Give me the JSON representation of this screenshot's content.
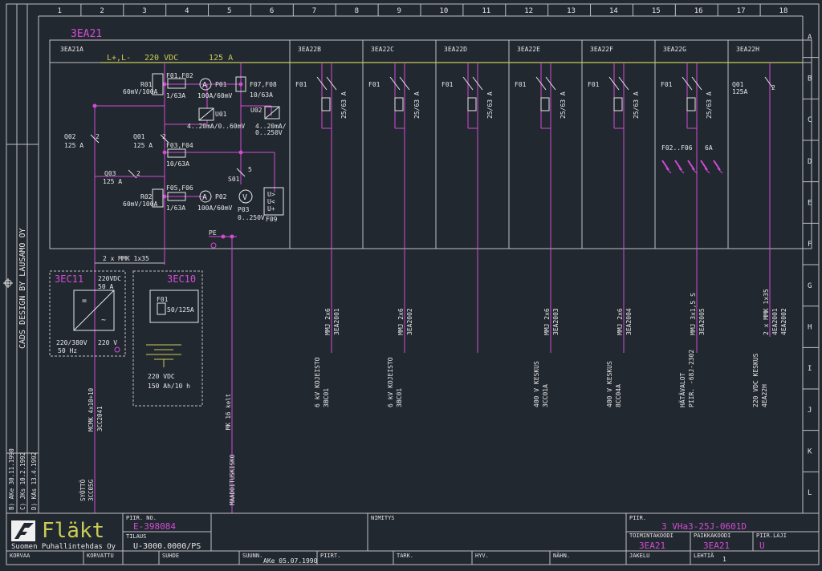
{
  "colors": {
    "background": "#222830",
    "frame": "#c0c0c0",
    "accent": "#d24bd6",
    "bus": "#c9cc55",
    "text": "#e6e6e6"
  },
  "grid": {
    "columns": [
      "1",
      "2",
      "3",
      "4",
      "5",
      "6",
      "7",
      "8",
      "9",
      "10",
      "11",
      "12",
      "13",
      "14",
      "15",
      "16",
      "17",
      "18"
    ],
    "rows": [
      "A",
      "B",
      "C",
      "D",
      "E",
      "F",
      "G",
      "H",
      "I",
      "J",
      "K",
      "L"
    ]
  },
  "main": {
    "title": "3EA21",
    "busbar": "L+,L-",
    "busbar_voltage": "220 VDC",
    "busbar_current": "125 A",
    "pe": "PE",
    "cable_top": "2 x MMK 1x35",
    "incoming": {
      "id": "3EA21A",
      "r01": "R01",
      "r01v": "60mV/100A",
      "f01": "F01,F02",
      "f01v": "1/63A",
      "p01": "P01",
      "p01v": "100A/60mV",
      "u01": "U01",
      "u01v": "4..20mA/0..60mV",
      "f07": "F07,F08",
      "f07v": "10/63A",
      "u02": "U02",
      "u02v": "4..20mA/",
      "u02v2": "0..250V",
      "q02": "Q02",
      "q02v": "125 A",
      "q02n": "2",
      "q01": "Q01",
      "q01v": "125 A",
      "q01n": "2",
      "f03": "F03,F04",
      "f03v": "10/63A",
      "q03": "Q03",
      "q03v": "125 A",
      "q03n": "2",
      "r02": "R02",
      "r02v": "60mV/100A",
      "f05": "F05,F06",
      "f05v": "1/63A",
      "p02": "P02",
      "p02v": "100A/60mV",
      "s01": "S01",
      "s01n": "5",
      "p03": "P03",
      "p03v": "0..250V",
      "f09": "F09",
      "f09l1": "U>",
      "f09l2": "U<",
      "f09l3": "U+",
      "sym_a": "A",
      "sym_v": "V"
    },
    "feeders": [
      {
        "id": "3EA22B",
        "dev": "F01",
        "rating": "25/63 A",
        "cable": "MMJ 2x6",
        "cable_id": "3EA2001",
        "dest": "6 kV KOJEISTO",
        "dest_id": "3BC01"
      },
      {
        "id": "3EA22C",
        "dev": "F01",
        "rating": "25/63 A",
        "cable": "MMJ 2x6",
        "cable_id": "3EA2002",
        "dest": "6 kV KOJEISTO",
        "dest_id": "3BC01"
      },
      {
        "id": "3EA22D",
        "dev": "F01",
        "rating": "25/63 A",
        "cable": "",
        "cable_id": "",
        "dest": "",
        "dest_id": ""
      },
      {
        "id": "3EA22E",
        "dev": "F01",
        "rating": "25/63 A",
        "cable": "MMJ 2x6",
        "cable_id": "3EA2003",
        "dest": "400 V KESKUS",
        "dest_id": "3CC01A"
      },
      {
        "id": "3EA22F",
        "dev": "F01",
        "rating": "25/63 A",
        "cable": "MMJ 2x6",
        "cable_id": "3EA2004",
        "dest": "400 V KESKUS",
        "dest_id": "8CC04A"
      },
      {
        "id": "3EA22G",
        "dev": "F01",
        "rating": "25/63 A",
        "cable": "MMJ 3x1,5 S",
        "cable_id": "3EA2005",
        "dest": "HÄTÄVALOT",
        "dest_id": "PIIR. -68J-2302"
      },
      {
        "id": "3EA22H",
        "dev": "Q01",
        "rating": "125A",
        "cable": "2 x MMK 1x35",
        "cable_id": "4EA2001",
        "cable_id2": "4EA2002",
        "dest": "220 VDC KESKUS",
        "dest_id": "4EA22H"
      }
    ],
    "g_fuses": {
      "label": "F02..F06",
      "rating": "6A"
    },
    "q01h_n": "2"
  },
  "charger": {
    "id": "3EC11",
    "dc": "220VDC",
    "dc_a": "50 A",
    "ac": "220/380V",
    "ac2": "50 Hz",
    "out": "220 V",
    "sym1": "=",
    "sym2": "~",
    "cable": "MCMK 4x10+10",
    "cable_id": "3CC2041",
    "src": "SYÖTTÖ",
    "src_id": "3CC05G"
  },
  "battery": {
    "id": "3EC10",
    "fuse": "F01",
    "fuse_v": "50/125A",
    "voltage": "220 VDC",
    "capacity": "150 Ah/10 h"
  },
  "earth": {
    "cable": "MK 16 kelt",
    "dest": "MAADOITUSKISKO"
  },
  "side": {
    "cads": "CADS DESIGN BY LAUSAMO OY",
    "revs": [
      "B) AKe 30.11.1990",
      "C) JKs 10.2.1992",
      "D) KAs 13.4.1992"
    ]
  },
  "titleblock": {
    "logo": "Fläkt",
    "company": "Suomen Puhallintehdas Oy",
    "piir_no_label": "PIIR. NO.",
    "piir_no": "E-398084",
    "tilaus_label": "TILAUS",
    "tilaus": "U-3000.0000/PS",
    "nimitys_label": "NIMITYS",
    "piir_label": "PIIR.",
    "piir": "3 VHa3-25J-0601D",
    "toim_label": "TOIMINTAKOODI",
    "toim": "3EA21",
    "paikka_label": "PAIKKAKOODI",
    "paikka": "3EA21",
    "laji_label": "PIIR.LAJI",
    "laji": "U",
    "korvaa": "KORVAA",
    "korvattu": "KORVATTU",
    "suhde": "SUHDE",
    "suunn_label": "SUUNN.",
    "suunn": "AKe 05.07.1990",
    "piirt": "PIIRT.",
    "tark": "TARK.",
    "hyv": "HYV.",
    "nahn": "NÄHN.",
    "jakelu": "JAKELU",
    "lehti_label": "LEHTIÄ",
    "lehti": "1"
  }
}
